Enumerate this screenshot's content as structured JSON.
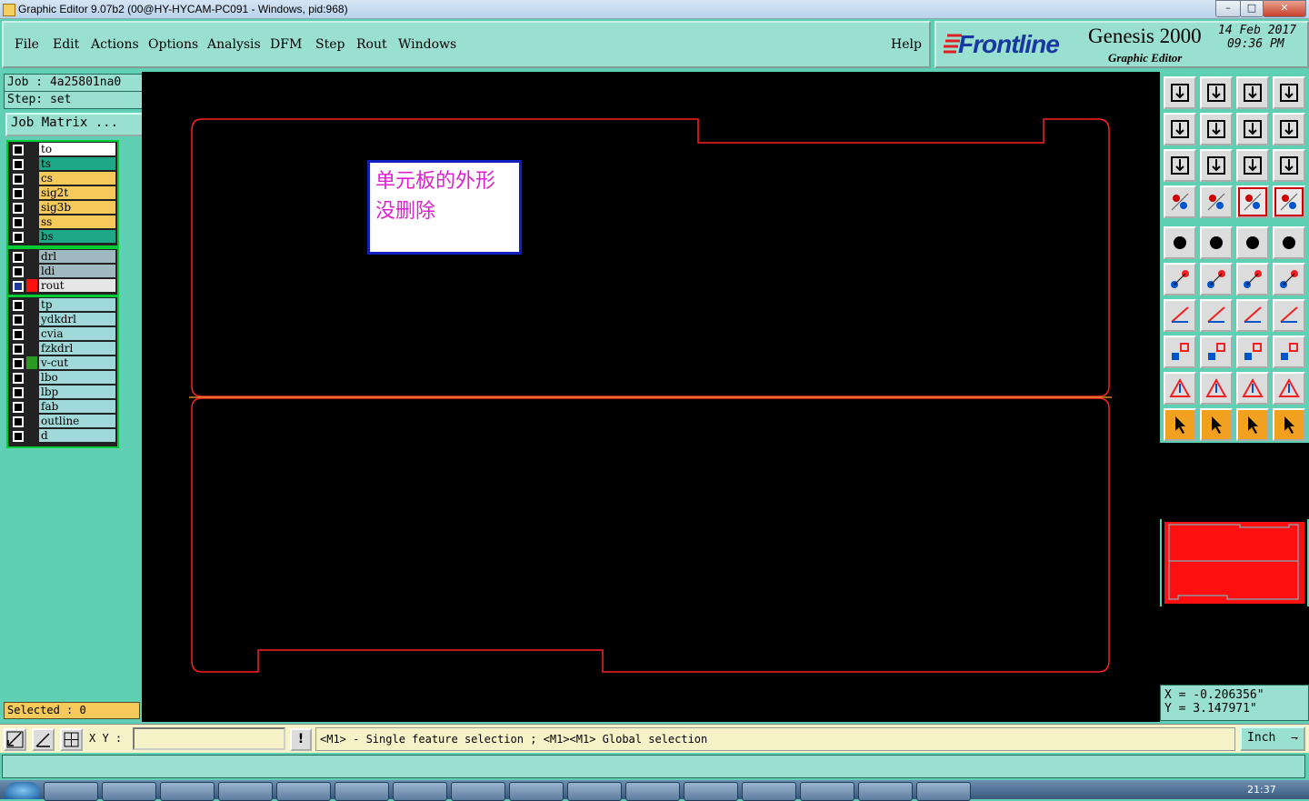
{
  "window": {
    "title": "Graphic Editor 9.07b2 (00@HY-HYCAM-PC091 - Windows, pid:968)",
    "controls": [
      "–",
      "□",
      "✕"
    ]
  },
  "menu": {
    "items": [
      "File",
      "Edit",
      "Actions",
      "Options",
      "Analysis",
      "DFM",
      "Step",
      "Rout",
      "Windows"
    ],
    "help": "Help"
  },
  "brand": {
    "logo": "Frontline",
    "product": "Genesis 2000",
    "subtitle": "Graphic Editor",
    "date": "14 Feb 2017",
    "time": "09:36 PM"
  },
  "job": {
    "job_label": "Job : 4a25801na0",
    "step_label": "Step: set",
    "matrix_button": "Job Matrix ..."
  },
  "layers": {
    "group1": [
      {
        "name": "to",
        "color": "#ffffff"
      },
      {
        "name": "ts",
        "color": "#1fa888"
      },
      {
        "name": "cs",
        "color": "#f5c95a"
      },
      {
        "name": "sig2t",
        "color": "#f5c95a"
      },
      {
        "name": "sig3b",
        "color": "#f5c95a"
      },
      {
        "name": "ss",
        "color": "#f5c95a"
      },
      {
        "name": "bs",
        "color": "#1fa888"
      }
    ],
    "group2": [
      {
        "name": "drl",
        "color": "#9fb9c0"
      },
      {
        "name": "ldi",
        "color": "#9fb9c0"
      },
      {
        "name": "rout",
        "color": "#e6e6e6",
        "active": true
      }
    ],
    "group3": [
      {
        "name": "tp",
        "color": "#9fd9d9"
      },
      {
        "name": "ydkdrl",
        "color": "#9fd9d9"
      },
      {
        "name": "cvia",
        "color": "#9fd9d9"
      },
      {
        "name": "fzkdrl",
        "color": "#9fd9d9"
      },
      {
        "name": "v-cut",
        "color": "#9fd9d9",
        "swatch": "#2a9a20"
      },
      {
        "name": "lbo",
        "color": "#9fd9d9"
      },
      {
        "name": "lbp",
        "color": "#9fd9d9"
      },
      {
        "name": "fab",
        "color": "#9fd9d9"
      },
      {
        "name": "outline",
        "color": "#9fd9d9"
      },
      {
        "name": "d",
        "color": "#9fd9d9"
      }
    ]
  },
  "selected": "Selected : 0",
  "annotation": {
    "line1": "单元板的外形",
    "line2": "没删除"
  },
  "coords": {
    "x": "X = -0.206356\"",
    "y": "Y = 3.147971\""
  },
  "bottom": {
    "xy_label": "X Y :",
    "xy_value": "",
    "hint": "<M1> - Single feature selection ; <M1><M1> Global selection",
    "units": "Inch"
  },
  "taskbar": {
    "clock": "21:37"
  },
  "colors": {
    "outline": "#ff2020",
    "vcut": "#d88a2a",
    "panel": "#5fd0b4",
    "menu_bg": "#9ae0d0",
    "annotation_text": "#e020d0"
  }
}
